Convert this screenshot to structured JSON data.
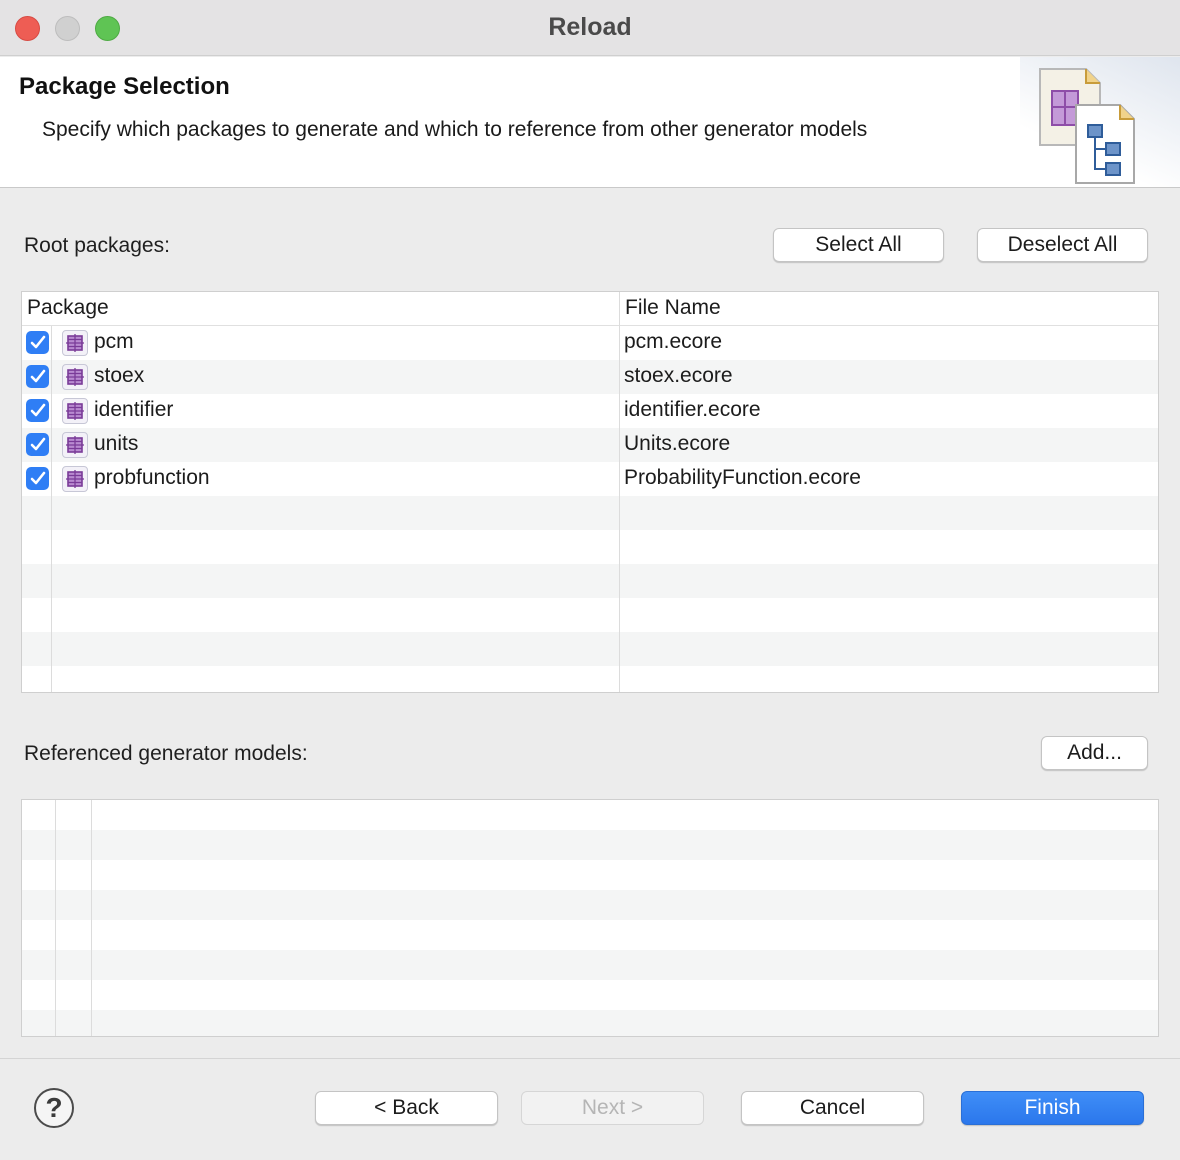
{
  "window": {
    "title": "Reload"
  },
  "banner": {
    "title": "Package Selection",
    "description": "Specify which packages to generate and which to reference from other generator models",
    "icon": "ecore-generator-wizard-icon"
  },
  "root_packages": {
    "label": "Root packages:",
    "select_all": "Select All",
    "deselect_all": "Deselect All",
    "columns": [
      "Package",
      "File Name"
    ],
    "rows": [
      {
        "checked": true,
        "package": "pcm",
        "file": "pcm.ecore"
      },
      {
        "checked": true,
        "package": "stoex",
        "file": "stoex.ecore"
      },
      {
        "checked": true,
        "package": "identifier",
        "file": "identifier.ecore"
      },
      {
        "checked": true,
        "package": "units",
        "file": "Units.ecore"
      },
      {
        "checked": true,
        "package": "probfunction",
        "file": "ProbabilityFunction.ecore"
      }
    ]
  },
  "referenced_models": {
    "label": "Referenced generator models:",
    "add": "Add..."
  },
  "footer": {
    "help": "?",
    "back": "< Back",
    "next": "Next >",
    "cancel": "Cancel",
    "finish": "Finish"
  },
  "colors": {
    "accent": "#2f7ef5",
    "primary_button": "#2b77ec",
    "package_icon": "#8e4ea8"
  }
}
